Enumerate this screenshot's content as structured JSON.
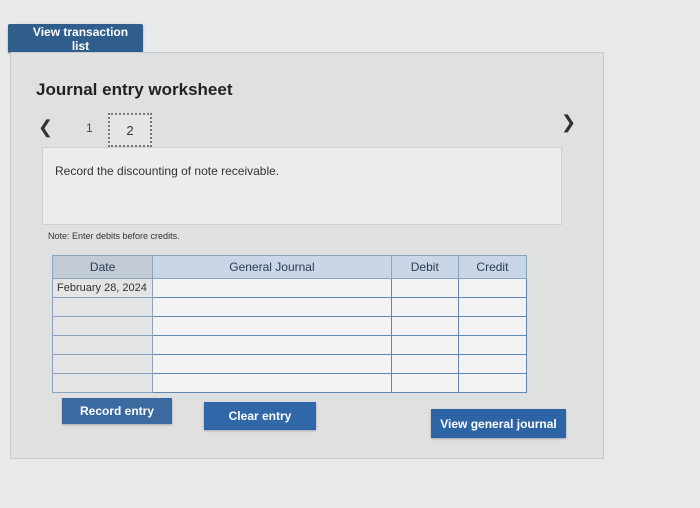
{
  "top": {
    "view_transaction_list": "View transaction list"
  },
  "worksheet": {
    "title": "Journal entry worksheet",
    "steps": [
      "1",
      "2"
    ],
    "current_step": "2",
    "instruction": "Record the discounting of note receivable.",
    "note": "Note: Enter debits before credits."
  },
  "table": {
    "columns": [
      "Date",
      "General Journal",
      "Debit",
      "Credit"
    ],
    "rows": [
      {
        "date": "February 28, 2024"
      },
      {
        "date": ""
      },
      {
        "date": ""
      },
      {
        "date": ""
      },
      {
        "date": ""
      },
      {
        "date": ""
      }
    ]
  },
  "buttons": {
    "record_entry": "Record entry",
    "clear_entry": "Clear entry",
    "view_general_journal": "View general journal"
  },
  "icons": {
    "prev": "chevron-left-icon",
    "next": "chevron-right-icon"
  },
  "colors": {
    "button_blue": "#2f67a8",
    "header_blue": "#c9d6e6"
  }
}
